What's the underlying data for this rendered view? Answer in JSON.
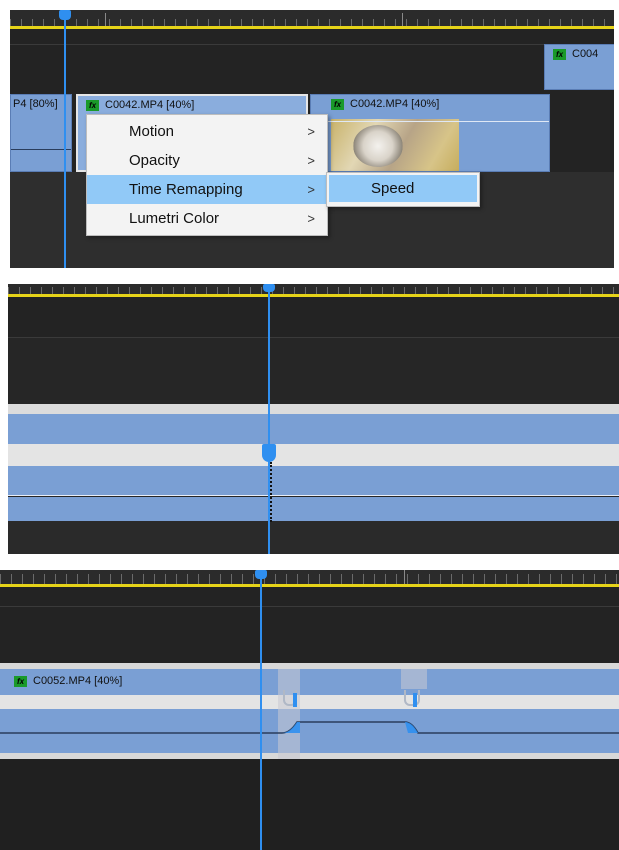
{
  "panel1": {
    "clip_left_label": "P4 [80%]",
    "clip_mid_label": "C0042.MP4 [40%]",
    "clip_right_label": "C0042.MP4 [40%]",
    "clip_top_right_label": "C004",
    "fx_badge": "fx",
    "context_menu": {
      "items": [
        {
          "label": "Motion",
          "arrow": ">"
        },
        {
          "label": "Opacity",
          "arrow": ">"
        },
        {
          "label": "Time Remapping",
          "arrow": ">",
          "selected": true
        },
        {
          "label": "Lumetri Color",
          "arrow": ">"
        }
      ],
      "submenu": {
        "label": "Speed"
      }
    }
  },
  "panel2": {},
  "panel3": {
    "clip_label": "C0052.MP4 [40%]",
    "fx_badge": "fx"
  },
  "colors": {
    "timeline_bg": "#232323",
    "clip_fill": "#7a9fd4",
    "playhead": "#2f8ff0",
    "work_area": "#e6d319",
    "fx_badge": "#1a9a2a",
    "menu_highlight": "#91c9f7"
  }
}
